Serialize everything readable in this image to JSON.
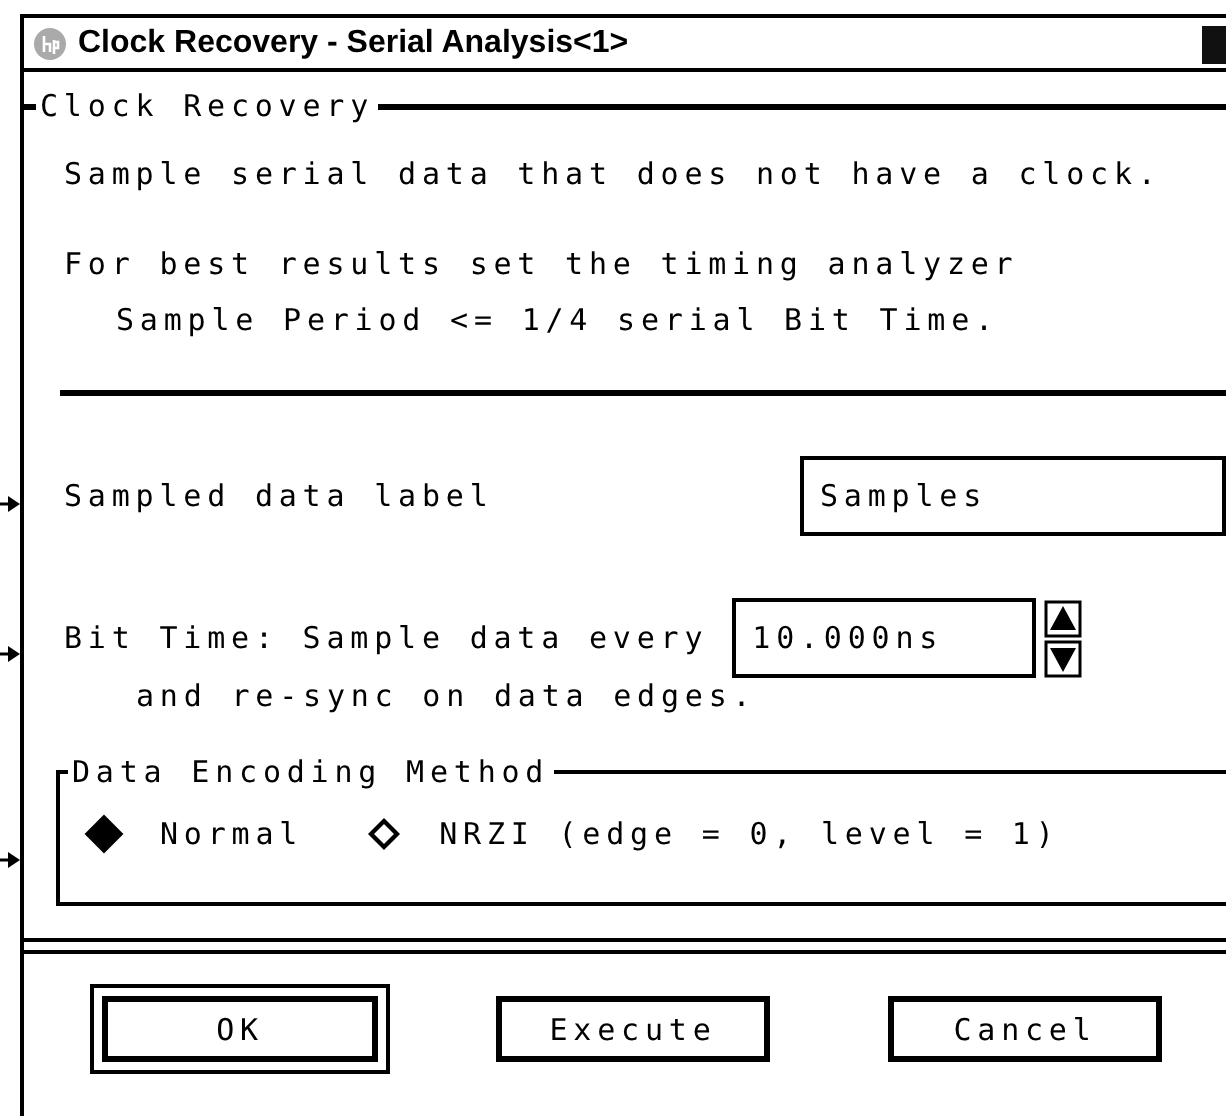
{
  "window": {
    "title": "Clock Recovery - Serial Analysis<1>"
  },
  "recovery": {
    "title": "Clock Recovery",
    "description": "Sample serial data that does not have a clock.",
    "hint_lines": [
      "For best results set the timing analyzer",
      "Sample Period <= 1/4 serial Bit Time."
    ]
  },
  "sampled": {
    "label": "Sampled data label",
    "value": "Samples"
  },
  "bit_time": {
    "label": "Bit Time: Sample data every",
    "value": "10.000ns",
    "note": "and re-sync on data edges."
  },
  "encoding": {
    "title": "Data Encoding Method",
    "options": [
      {
        "label": "Normal",
        "selected": true
      },
      {
        "label": "NRZI (edge = 0, level = 1)",
        "selected": false
      }
    ]
  },
  "buttons": [
    {
      "label": "OK",
      "default": true
    },
    {
      "label": "Execute",
      "default": false
    },
    {
      "label": "Cancel",
      "default": false
    }
  ]
}
